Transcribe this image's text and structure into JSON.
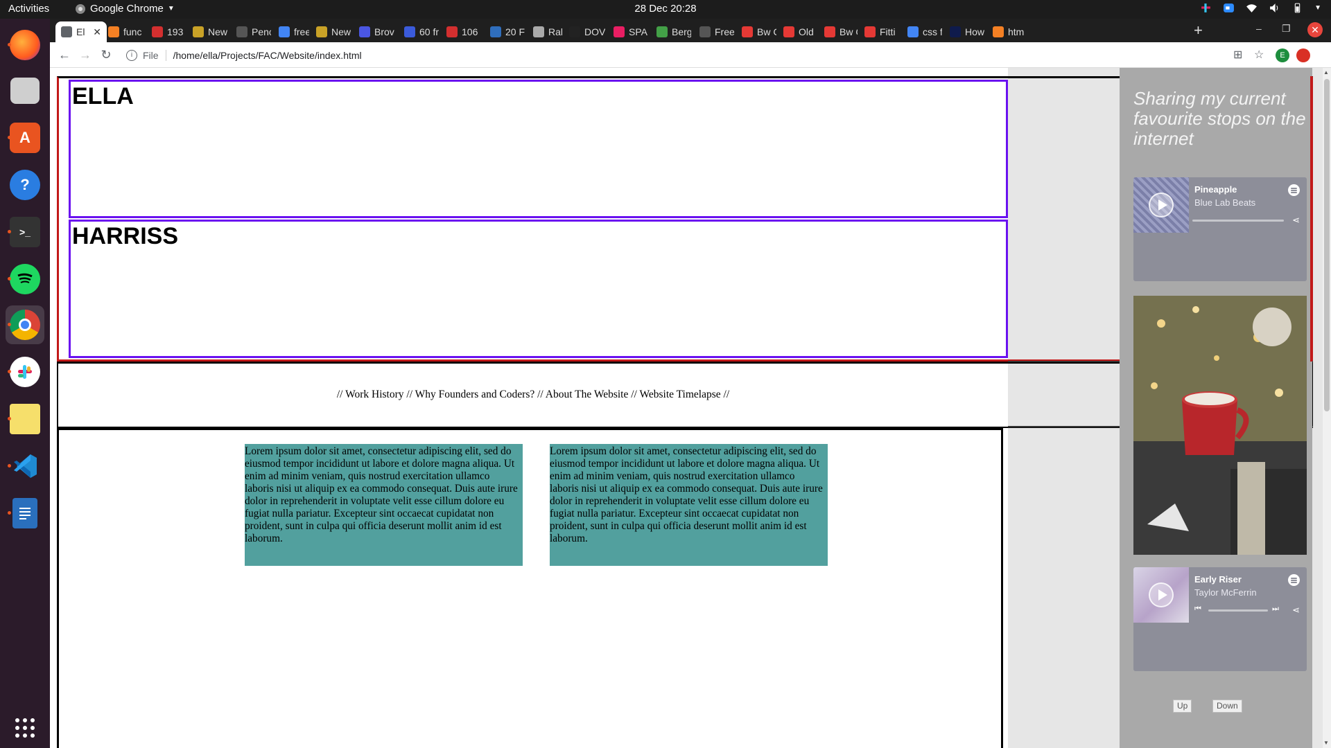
{
  "topbar": {
    "activities": "Activities",
    "app_name": "Google Chrome",
    "clock": "28 Dec  20:28"
  },
  "dock": {
    "items": [
      "Firefox",
      "Files",
      "Ubuntu Software",
      "Help",
      "Terminal",
      "Spotify",
      "Google Chrome",
      "Slack",
      "Sticky Notes",
      "Visual Studio Code",
      "LibreOffice Writer"
    ],
    "apps_grid": "Show Applications"
  },
  "browser": {
    "tabs": [
      {
        "label": "El",
        "icon": "chrome-page-icon",
        "color": "#5f6368"
      },
      {
        "label": "func",
        "icon": "stackoverflow-icon",
        "color": "#f48024"
      },
      {
        "label": "193",
        "icon": "f-icon",
        "color": "#d32f2f"
      },
      {
        "label": "New",
        "icon": "newspaper-icon",
        "color": "#c9a227"
      },
      {
        "label": "Penc",
        "icon": "circle-icon",
        "color": "#555555"
      },
      {
        "label": "free",
        "icon": "google-icon",
        "color": "#4285f4"
      },
      {
        "label": "New",
        "icon": "newspaper-icon",
        "color": "#c9a227"
      },
      {
        "label": "Brov",
        "icon": "f-blue-icon",
        "color": "#4a56e2"
      },
      {
        "label": "60 fr",
        "icon": "c-blue-icon",
        "color": "#3b5bdb"
      },
      {
        "label": "106",
        "icon": "f-icon",
        "color": "#d32f2f"
      },
      {
        "label": "20 F",
        "icon": "bo-icon",
        "color": "#2f6ebd"
      },
      {
        "label": "Rale",
        "icon": "dot-icon",
        "color": "#aaaaaa"
      },
      {
        "label": "DOV",
        "icon": "f-dark-icon",
        "color": "#222222"
      },
      {
        "label": "SPAI",
        "icon": "p-icon",
        "color": "#e91e63"
      },
      {
        "label": "Berg",
        "icon": "leaf-icon",
        "color": "#43a047"
      },
      {
        "label": "Free",
        "icon": "circle-icon",
        "color": "#555555"
      },
      {
        "label": "Bw C",
        "icon": "d-icon",
        "color": "#e53935"
      },
      {
        "label": "Old",
        "icon": "d-icon",
        "color": "#e53935"
      },
      {
        "label": "Bw C",
        "icon": "d-icon",
        "color": "#e53935"
      },
      {
        "label": "Fitti",
        "icon": "gear-icon",
        "color": "#e53935"
      },
      {
        "label": "css f",
        "icon": "google-icon",
        "color": "#4285f4"
      },
      {
        "label": "How",
        "icon": "a-icon",
        "color": "#0f1b4c"
      },
      {
        "label": "htm",
        "icon": "stackoverflow-icon",
        "color": "#f48024"
      }
    ],
    "new_tab": "+",
    "address": {
      "scheme": "File",
      "url": "/home/ella/Projects/FAC/Website/index.html"
    },
    "profile_initial": "E"
  },
  "page": {
    "name_first": "ELLA",
    "name_last": "HARRISS",
    "nav_links": [
      "Work History",
      "Why Founders and Coders?",
      "About The Website",
      "Website Timelapse"
    ],
    "nav_separator": "//",
    "cards": [
      "Lorem ipsum dolor sit amet, consectetur adipiscing elit, sed do eiusmod tempor incididunt ut labore et dolore magna aliqua. Ut enim ad minim veniam, quis nostrud exercitation ullamco laboris nisi ut aliquip ex ea commodo consequat. Duis aute irure dolor in reprehenderit in voluptate velit esse cillum dolore eu fugiat nulla pariatur. Excepteur sint occaecat cupidatat non proident, sunt in culpa qui officia deserunt mollit anim id est laborum.",
      "Lorem ipsum dolor sit amet, consectetur adipiscing elit, sed do eiusmod tempor incididunt ut labore et dolore magna aliqua. Ut enim ad minim veniam, quis nostrud exercitation ullamco laboris nisi ut aliquip ex ea commodo consequat. Duis aute irure dolor in reprehenderit in voluptate velit esse cillum dolore eu fugiat nulla pariatur. Excepteur sint occaecat cupidatat non proident, sunt in culpa qui officia deserunt mollit anim id est laborum."
    ],
    "card_color": "#52a09e",
    "sidebar": {
      "heading": "Sharing my current favourite stops on the internet",
      "players": [
        {
          "title": "Pineapple",
          "artist": "Blue Lab Beats"
        },
        {
          "title": "Early Riser",
          "artist": "Taylor McFerrin"
        }
      ],
      "up_label": "Up",
      "down_label": "Down"
    }
  },
  "colors": {
    "accent_purple": "#6a11f0",
    "accent_red": "#c21a1a",
    "player_bg": "#8d8e99",
    "sidebar_bg": "#a9a9a9"
  }
}
